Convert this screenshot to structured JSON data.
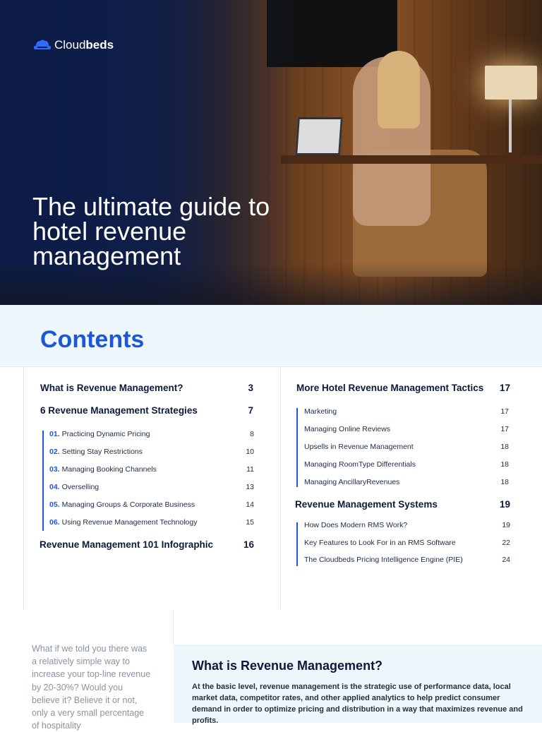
{
  "hero": {
    "logo": {
      "text_regular": "Cloud",
      "text_bold": "beds"
    },
    "title": "The ultimate guide to hotel revenue management"
  },
  "contents": {
    "title": "Contents",
    "left": [
      {
        "label": "What is Revenue Management?",
        "page": "3"
      },
      {
        "label": "6 Revenue Management Strategies",
        "page": "7",
        "children": [
          {
            "num": "01.",
            "label": "Practicing Dynamic Pricing",
            "page": "8"
          },
          {
            "num": "02.",
            "label": "Setting Stay Restrictions",
            "page": "10"
          },
          {
            "num": "03.",
            "label": "Managing Booking Channels",
            "page": "11"
          },
          {
            "num": "04.",
            "label": "Overselling",
            "page": "13"
          },
          {
            "num": "05.",
            "label": "Managing Groups & Corporate Business",
            "page": "14"
          },
          {
            "num": "06.",
            "label": "Using Revenue Management Technology",
            "page": "15"
          }
        ]
      },
      {
        "label": "Revenue Management 101 Infographic",
        "page": "16"
      }
    ],
    "right": [
      {
        "label": "More Hotel Revenue Management Tactics",
        "page": "17",
        "children": [
          {
            "label": "Marketing",
            "page": "17"
          },
          {
            "label": "Managing Online Reviews",
            "page": "17"
          },
          {
            "label": "Upsells in Revenue Management",
            "page": "18"
          },
          {
            "label": "Managing RoomType Differentials",
            "page": "18"
          },
          {
            "label": "Managing AncillaryRevenues",
            "page": "18"
          }
        ]
      },
      {
        "label": "Revenue Management Systems",
        "page": "19",
        "children": [
          {
            "label": "How Does Modern RMS Work?",
            "page": "19"
          },
          {
            "label": "Key Features to Look For in an RMS Software",
            "page": "22"
          },
          {
            "label": "The Cloudbeds Pricing Intelligence Engine (PIE)",
            "page": "24"
          }
        ]
      }
    ]
  },
  "intro": "What if we told you there was a relatively simple way to increase your top-line revenue by 20-30%? Would you believe it? Believe it or not, only a very small percentage of hospitality",
  "section": {
    "title": "What is Revenue Management?",
    "body": "At the basic level, revenue management is the strategic use of performance data, local market data, competitor rates, and other applied analytics to help predict consumer demand in order to optimize pricing and distribution in a way that maximizes revenue and profits."
  },
  "colors": {
    "accent": "#1d56d6",
    "navy": "#0b1a3a",
    "band": "#eef7fb"
  }
}
